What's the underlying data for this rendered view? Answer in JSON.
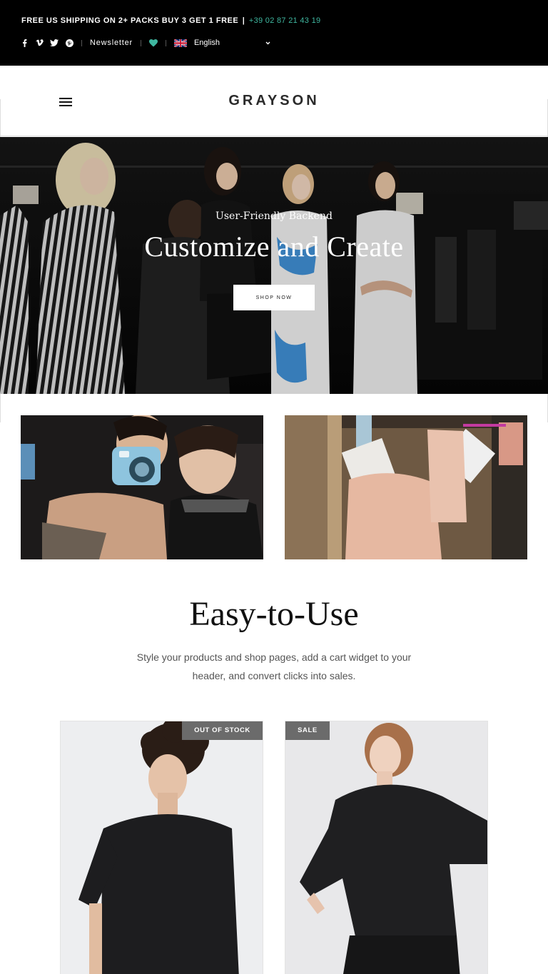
{
  "topbar": {
    "promo": "FREE US SHIPPING ON 2+ PACKS BUY 3 GET 1 FREE",
    "separator": "|",
    "phone": "+39 02 87 21 43 19",
    "social_icons": [
      "facebook-icon",
      "vimeo-icon",
      "twitter-icon",
      "pinterest-icon"
    ],
    "newsletter": "Newsletter",
    "language": "English",
    "heart_color": "#3fb7a0"
  },
  "header": {
    "logo": "GRAYSON"
  },
  "hero": {
    "subtitle": "User-Friendly Backend",
    "title": "Customize and Create",
    "button": "SHOP NOW"
  },
  "section": {
    "title": "Easy-to-Use",
    "text": "Style your products and shop pages, add a cart widget to your header, and convert clicks into sales."
  },
  "products": [
    {
      "badge": "OUT OF STOCK"
    },
    {
      "badge": "SALE"
    }
  ],
  "colors": {
    "accent": "#3fb7a0",
    "topbar_bg": "#000000",
    "badge_bg": "#6b6b6b"
  }
}
